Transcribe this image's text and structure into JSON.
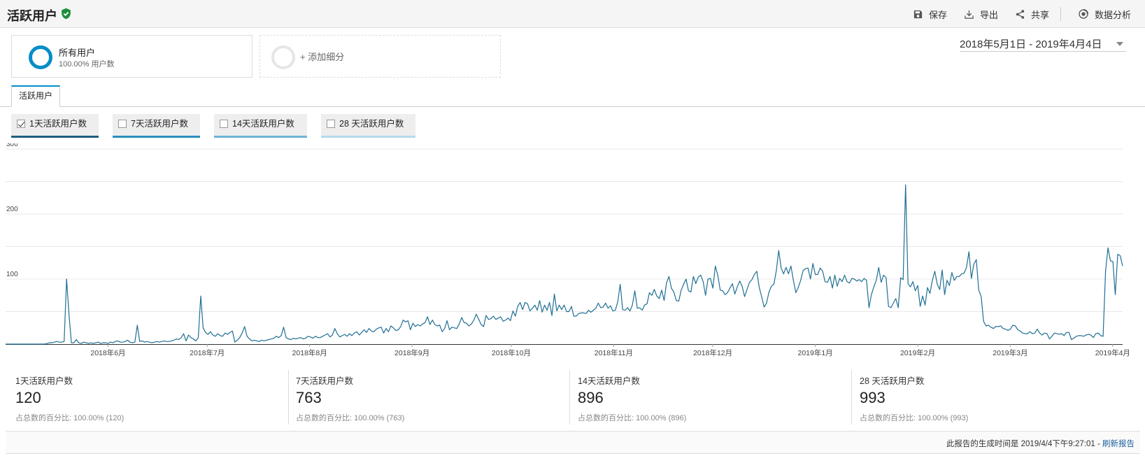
{
  "header": {
    "title": "活跃用户",
    "actions": [
      {
        "label": "保存",
        "icon": "save-icon"
      },
      {
        "label": "导出",
        "icon": "export-icon"
      },
      {
        "label": "共享",
        "icon": "share-icon"
      },
      {
        "label": "数据分析",
        "icon": "insights-icon"
      }
    ]
  },
  "segments": {
    "active": {
      "name": "所有用户",
      "sub": "100.00% 用户数",
      "color": "#058dc7"
    },
    "add_label": "+ 添加细分"
  },
  "date_range": "2018年5月1日 - 2019年4月4日",
  "tab": {
    "label": "活跃用户"
  },
  "metric_chips": [
    {
      "label": "1天活跃用户数",
      "checked": true,
      "color": "#1f5e83"
    },
    {
      "label": "7天活跃用户数",
      "checked": false,
      "color": "#2a8fbd"
    },
    {
      "label": "14天活跃用户数",
      "checked": false,
      "color": "#6eb5d6"
    },
    {
      "label": "28 天活跃用户数",
      "checked": false,
      "color": "#b7d9ea"
    }
  ],
  "summary": [
    {
      "label": "1天活跃用户数",
      "value": "120",
      "pct": "占总数的百分比: 100.00% (120)"
    },
    {
      "label": "7天活跃用户数",
      "value": "763",
      "pct": "占总数的百分比: 100.00% (763)"
    },
    {
      "label": "14天活跃用户数",
      "value": "896",
      "pct": "占总数的百分比: 100.00% (896)"
    },
    {
      "label": "28 天活跃用户数",
      "value": "993",
      "pct": "占总数的百分比: 100.00% (993)"
    }
  ],
  "footer": {
    "text": "此报告的生成时间是 2019/4/4下午9:27:01 - ",
    "link": "刷新报告"
  },
  "chart_data": {
    "type": "line",
    "x_start": "2018-05-01",
    "x_end": "2019-04-04",
    "ylim": [
      0,
      300
    ],
    "yticks": [
      100,
      200,
      300
    ],
    "grid": true,
    "line_color": "#1f6f94",
    "x_tick_labels": [
      {
        "label": "2018年6月",
        "date": "2018-06-01"
      },
      {
        "label": "2018年7月",
        "date": "2018-07-01"
      },
      {
        "label": "2018年8月",
        "date": "2018-08-01"
      },
      {
        "label": "2018年9月",
        "date": "2018-09-01"
      },
      {
        "label": "2018年10月",
        "date": "2018-10-01"
      },
      {
        "label": "2018年11月",
        "date": "2018-11-01"
      },
      {
        "label": "2018年12月",
        "date": "2018-12-01"
      },
      {
        "label": "2019年1月",
        "date": "2019-01-01"
      },
      {
        "label": "2019年2月",
        "date": "2019-02-01"
      },
      {
        "label": "2019年3月",
        "date": "2019-03-01"
      },
      {
        "label": "2019年4月",
        "date": "2019-04-01"
      }
    ],
    "series": [
      {
        "values": [
          0,
          0,
          0,
          0,
          0,
          0,
          0,
          0,
          0,
          0,
          0,
          0,
          0,
          0,
          0,
          0,
          0,
          1,
          2,
          2,
          3,
          4,
          3,
          3,
          4,
          100,
          45,
          2,
          2,
          7,
          2,
          1,
          3,
          2,
          1,
          2,
          1,
          2,
          3,
          1,
          2,
          2,
          1,
          3,
          2,
          4,
          5,
          3,
          3,
          4,
          6,
          3,
          2,
          3,
          29,
          4,
          5,
          3,
          4,
          3,
          2,
          3,
          4,
          3,
          4,
          5,
          4,
          4,
          5,
          6,
          8,
          7,
          10,
          16,
          5,
          14,
          10,
          8,
          5,
          10,
          74,
          25,
          18,
          15,
          19,
          14,
          12,
          16,
          13,
          12,
          17,
          15,
          18,
          20,
          3,
          6,
          10,
          17,
          27,
          12,
          8,
          5,
          6,
          5,
          4,
          6,
          5,
          6,
          7,
          8,
          9,
          12,
          10,
          13,
          26,
          10,
          8,
          7,
          9,
          8,
          9,
          10,
          8,
          9,
          12,
          11,
          9,
          12,
          10,
          10,
          12,
          14,
          16,
          11,
          14,
          24,
          16,
          11,
          13,
          15,
          12,
          16,
          13,
          17,
          19,
          14,
          18,
          22,
          18,
          24,
          20,
          19,
          23,
          25,
          26,
          17,
          24,
          19,
          28,
          25,
          21,
          22,
          27,
          37,
          34,
          36,
          22,
          32,
          27,
          30,
          28,
          31,
          33,
          42,
          30,
          37,
          30,
          28,
          29,
          19,
          24,
          36,
          22,
          26,
          25,
          24,
          31,
          41,
          33,
          32,
          28,
          31,
          37,
          46,
          38,
          30,
          27,
          44,
          38,
          39,
          43,
          38,
          40,
          42,
          35,
          37,
          40,
          36,
          51,
          43,
          58,
          64,
          53,
          64,
          62,
          51,
          55,
          60,
          52,
          67,
          49,
          60,
          52,
          64,
          44,
          77,
          51,
          60,
          53,
          60,
          50,
          50,
          58,
          43,
          43,
          47,
          48,
          48,
          47,
          52,
          49,
          52,
          55,
          63,
          56,
          57,
          63,
          55,
          59,
          51,
          52,
          65,
          92,
          53,
          52,
          56,
          51,
          60,
          82,
          55,
          56,
          52,
          60,
          62,
          79,
          75,
          84,
          74,
          70,
          83,
          67,
          94,
          104,
          86,
          80,
          67,
          66,
          83,
          92,
          100,
          82,
          80,
          104,
          93,
          103,
          106,
          96,
          75,
          100,
          101,
          86,
          120,
          106,
          83,
          82,
          76,
          79,
          86,
          93,
          77,
          88,
          97,
          89,
          73,
          84,
          95,
          99,
          107,
          112,
          87,
          73,
          57,
          63,
          80,
          89,
          92,
          113,
          144,
          117,
          108,
          118,
          108,
          120,
          98,
          79,
          87,
          98,
          113,
          116,
          117,
          100,
          124,
          107,
          107,
          117,
          112,
          96,
          95,
          104,
          86,
          106,
          89,
          101,
          96,
          106,
          96,
          94,
          101,
          100,
          97,
          99,
          96,
          101,
          98,
          56,
          76,
          88,
          98,
          118,
          95,
          106,
          102,
          58,
          56,
          63,
          70,
          56,
          102,
          99,
          245,
          93,
          88,
          96,
          82,
          90,
          58,
          74,
          60,
          87,
          78,
          98,
          112,
          92,
          84,
          114,
          76,
          98,
          90,
          110,
          98,
          104,
          104,
          108,
          109,
          118,
          142,
          101,
          123,
          130,
          83,
          73,
          35,
          28,
          29,
          26,
          24,
          27,
          27,
          28,
          24,
          23,
          21,
          23,
          29,
          28,
          22,
          20,
          17,
          16,
          16,
          19,
          16,
          17,
          23,
          17,
          14,
          17,
          16,
          8,
          12,
          17,
          16,
          15,
          16,
          13,
          18,
          18,
          7,
          9,
          12,
          13,
          13,
          12,
          14,
          15,
          14,
          10,
          16,
          17,
          13,
          12,
          112,
          148,
          128,
          127,
          76,
          138,
          136,
          120
        ]
      }
    ]
  }
}
